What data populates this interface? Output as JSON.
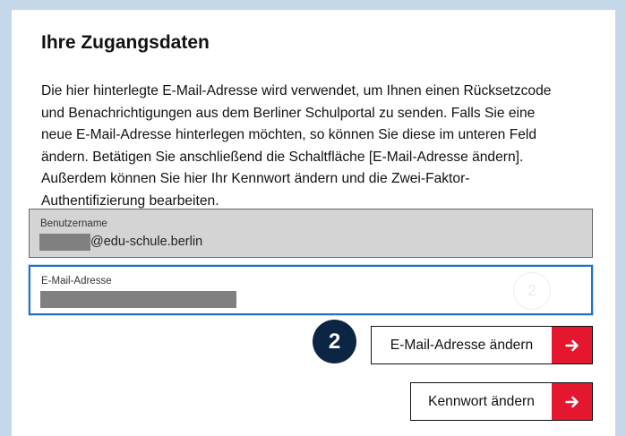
{
  "section": {
    "title": "Ihre Zugangsdaten",
    "description_lines": [
      "Die hier hinterlegte E-Mail-Adresse wird verwendet, um Ihnen einen Rücksetzcode",
      "und Benachrichtigungen aus dem Berliner Schulportal zu senden. Falls Sie eine",
      "neue E-Mail-Adresse hinterlegen möchten, so können Sie diese im unteren Feld",
      "ändern. Betätigen Sie anschließend die Schaltfläche [E-Mail-Adresse ändern].",
      "Außerdem können Sie hier Ihr Kennwort ändern und die Zwei-Faktor-",
      "Authentifizierung bearbeiten."
    ]
  },
  "username": {
    "label": "Benutzername",
    "domain_suffix": "@edu-schule.berlin"
  },
  "email": {
    "label": "E-Mail-Adresse"
  },
  "step_badge": {
    "number": "2"
  },
  "ghost_badge": {
    "number": "2"
  },
  "buttons": {
    "change_email": "E-Mail-Adresse ändern",
    "change_password": "Kennwort ändern"
  },
  "colors": {
    "accent_red": "#e4172e",
    "badge_navy": "#0d2544",
    "focus_blue": "#1f72c9",
    "page_background": "#c4d8ea"
  },
  "icons": {
    "button_arrow": "arrow-right-icon"
  }
}
